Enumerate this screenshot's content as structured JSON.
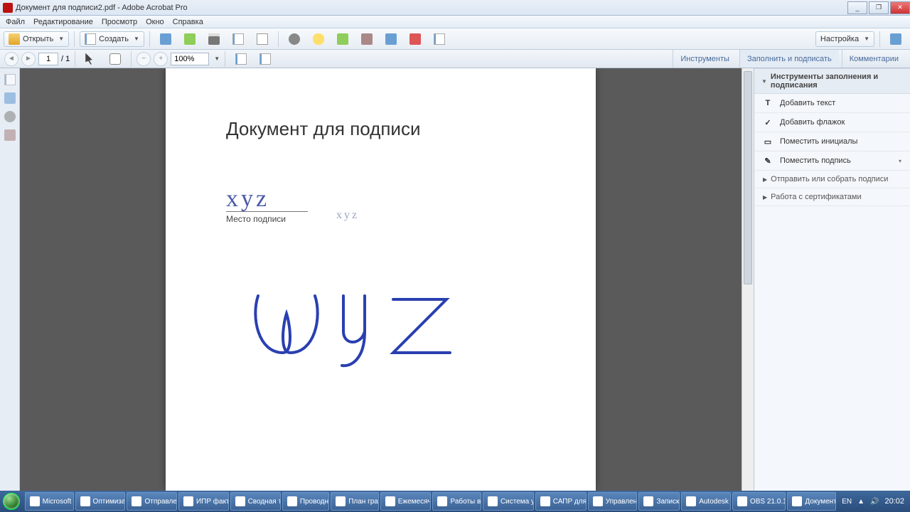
{
  "window": {
    "title": "Документ для подписи2.pdf - Adobe Acrobat Pro",
    "min": "_",
    "max": "❐",
    "close": "✕"
  },
  "menu": [
    "Файл",
    "Редактирование",
    "Просмотр",
    "Окно",
    "Справка"
  ],
  "toolbar1": {
    "open": "Открыть",
    "create": "Создать",
    "settings": "Настройка"
  },
  "toolbar2": {
    "page_current": "1",
    "page_total": "/ 1",
    "zoom": "100%",
    "right_tabs": [
      "Инструменты",
      "Заполнить и подписать",
      "Комментарии"
    ],
    "active_tab_index": 1
  },
  "document": {
    "heading": "Документ для подписи",
    "signature_field_label": "Место подписи",
    "signature_text_main": "xyz",
    "signature_text_small": "xyz"
  },
  "right_panel": {
    "section1_title": "Инструменты заполнения и подписания",
    "tools": [
      {
        "icon": "T",
        "label": "Добавить текст"
      },
      {
        "icon": "✓",
        "label": "Добавить флажок"
      },
      {
        "icon": "▭",
        "label": "Поместить инициалы"
      },
      {
        "icon": "✎",
        "label": "Поместить подпись",
        "caret": true
      }
    ],
    "section2_title": "Отправить или собрать подписи",
    "section3_title": "Работа с сертификатами"
  },
  "taskbar": {
    "items": [
      "Microsoft ...",
      "Оптимиза...",
      "Отправле...",
      "ИПР факт...",
      "Сводная т...",
      "Проводн...",
      "План гра...",
      "Ежемесяч...",
      "Работы в...",
      "Система у...",
      "САПР для...",
      "Управлен...",
      "Записки",
      "Autodesk ...",
      "OBS 21.0.1...",
      "Документ..."
    ],
    "lang": "EN",
    "time": "20:02"
  }
}
